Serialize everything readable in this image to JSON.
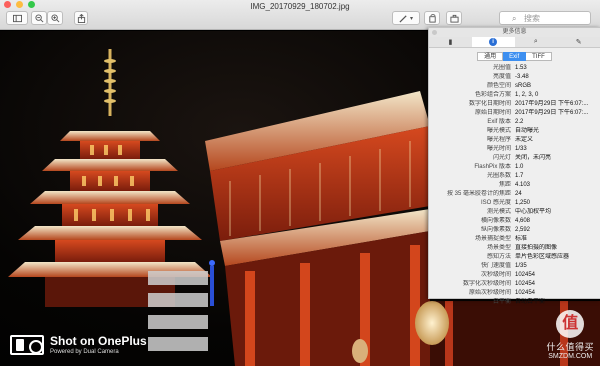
{
  "window": {
    "title": "IMG_20170929_180702.jpg"
  },
  "toolbar": {
    "search_placeholder": "搜索"
  },
  "inspector": {
    "title": "更多信息",
    "tabs": [
      "file-icon",
      "info-icon",
      "magnifier-icon",
      "pen-icon"
    ],
    "segments": [
      {
        "label": "通用",
        "active": false
      },
      {
        "label": "Exif",
        "active": true
      },
      {
        "label": "TIFF",
        "active": false
      }
    ],
    "rows": [
      {
        "key": "光圈值",
        "value": "1.53"
      },
      {
        "key": "亮度值",
        "value": "-3.48"
      },
      {
        "key": "颜色空间",
        "value": "sRGB"
      },
      {
        "key": "色彩组合方案",
        "value": "1, 2, 3, 0"
      },
      {
        "key": "数字化日期时间",
        "value": "2017年9月29日 下午6:07:..."
      },
      {
        "key": "原始日期时间",
        "value": "2017年9月29日 下午6:07:..."
      },
      {
        "key": "Exif 版本",
        "value": "2.2"
      },
      {
        "key": "曝光模式",
        "value": "自动曝光"
      },
      {
        "key": "曝光程序",
        "value": "未定义"
      },
      {
        "key": "曝光时间",
        "value": "1/33"
      },
      {
        "key": "闪光灯",
        "value": "关闭，未闪亮"
      },
      {
        "key": "FlashPix 版本",
        "value": "1.0"
      },
      {
        "key": "光圈系数",
        "value": "1.7"
      },
      {
        "key": "焦距",
        "value": "4.103"
      },
      {
        "key": "按 35 毫米胶卷计的焦距",
        "value": "24"
      },
      {
        "key": "ISO 感光度",
        "value": "1,250"
      },
      {
        "key": "测光模式",
        "value": "中心加权平均"
      },
      {
        "key": "横向像素数",
        "value": "4,608"
      },
      {
        "key": "纵向像素数",
        "value": "2,592"
      },
      {
        "key": "场景捕捉类型",
        "value": "标准"
      },
      {
        "key": "场景类型",
        "value": "直接拍摄的图像"
      },
      {
        "key": "感知方法",
        "value": "单片色彩区域感应器"
      },
      {
        "key": "快门速度值",
        "value": "1/35"
      },
      {
        "key": "次秒级时间",
        "value": "102454"
      },
      {
        "key": "数字化次秒级时间",
        "value": "102454"
      },
      {
        "key": "原始次秒级时间",
        "value": "102454"
      },
      {
        "key": "白平衡",
        "value": "自动白平衡"
      }
    ]
  },
  "watermark": {
    "title": "Shot on OnePlus",
    "subtitle": "Powered by Dual Camera"
  },
  "site_watermark": {
    "badge": "值",
    "text": "什么值得买",
    "sub": "SMZDM.COM"
  },
  "colors": {
    "accent": "#3d8ff0",
    "info": "#2a6fd6"
  }
}
